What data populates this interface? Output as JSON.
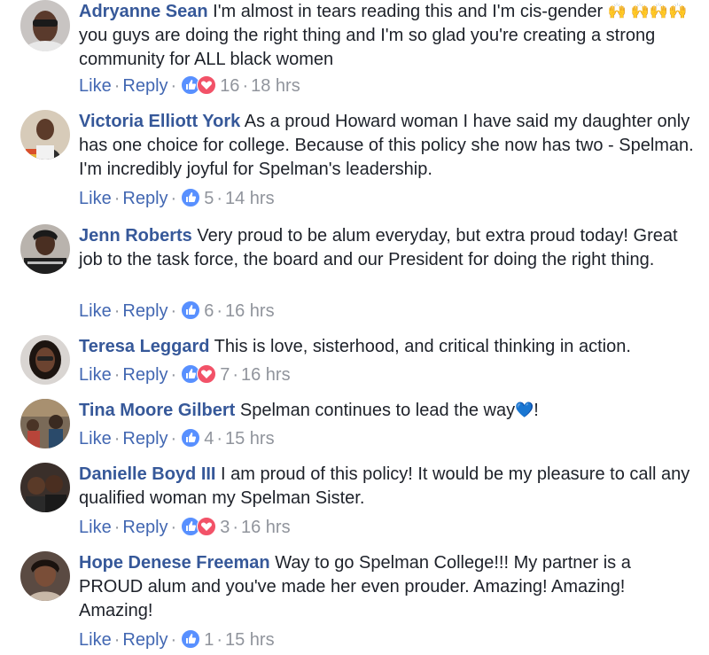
{
  "actions": {
    "like_label": "Like",
    "reply_label": "Reply",
    "separator": "·"
  },
  "comments": [
    {
      "author": "Adryanne Sean",
      "text_parts": [
        "I'm almost in tears reading this and I'm cis-gender ",
        " you guys are doing the right thing and I'm so glad you're creating a strong community for ALL black women"
      ],
      "emoji": "🙌 🙌🙌🙌",
      "reactions": [
        "like",
        "love"
      ],
      "count": "16",
      "time": "18 hrs"
    },
    {
      "author": "Victoria Elliott York",
      "text": "As a proud Howard woman I have said my daughter only has one choice for college. Because of this policy she now has two - Spelman. I'm incredibly joyful for Spelman's leadership.",
      "reactions": [
        "like"
      ],
      "count": "5",
      "time": "14 hrs"
    },
    {
      "author": "Jenn Roberts",
      "text": "Very proud to be alum everyday, but extra proud today! Great job to the task force, the board and our President for doing the right thing.",
      "reactions": [
        "like"
      ],
      "count": "6",
      "time": "16 hrs"
    },
    {
      "author": "Teresa Leggard",
      "text": "This is love, sisterhood, and critical thinking in action.",
      "reactions": [
        "like",
        "love"
      ],
      "count": "7",
      "time": "16 hrs"
    },
    {
      "author": "Tina Moore Gilbert",
      "text_parts": [
        "Spelman continues to lead the way",
        "!"
      ],
      "emoji": "💙",
      "reactions": [
        "like"
      ],
      "count": "4",
      "time": "15 hrs"
    },
    {
      "author": "Danielle Boyd III",
      "text": "I am proud of this policy! It would be my pleasure to call any qualified woman my Spelman Sister.",
      "reactions": [
        "like",
        "love"
      ],
      "count": "3",
      "time": "16 hrs"
    },
    {
      "author": "Hope Denese Freeman",
      "text": "Way to go Spelman College!!! My partner is a PROUD alum and you've made her even prouder. Amazing! Amazing! Amazing!",
      "reactions": [
        "like"
      ],
      "count": "1",
      "time": "15 hrs"
    }
  ],
  "colors": {
    "name": "#365899",
    "link": "#4267b2",
    "meta": "#90949c",
    "text": "#1d2129",
    "like": "#5890ff",
    "love": "#f25268"
  }
}
